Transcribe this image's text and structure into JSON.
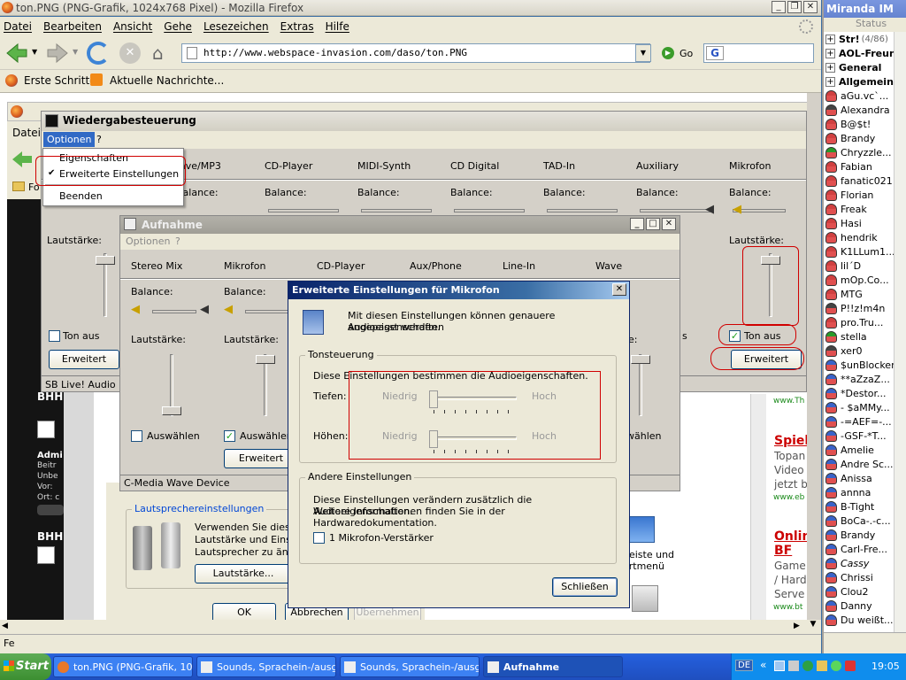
{
  "firefox": {
    "title": "ton.PNG (PNG-Grafik, 1024x768 Pixel) - Mozilla Firefox",
    "menu": [
      "Datei",
      "Bearbeiten",
      "Ansicht",
      "Gehe",
      "Lesezeichen",
      "Extras",
      "Hilfe"
    ],
    "url": "http://www.webspace-invasion.com/daso/ton.PNG",
    "go_label": "Go",
    "bookmarks": [
      "Erste Schritte",
      "Aktuelle Nachrichte..."
    ],
    "status": "Fe"
  },
  "background_page": {
    "lautsprecher_title": "Lautsprechereinstellungen",
    "lautsprecher_text": [
      "Verwenden Sie diese",
      "Lautstärke und Einste",
      "Lautsprecher zu ände"
    ],
    "lautstaerke_btn": "Lautstärke...",
    "ok_btn": "OK",
    "abbrechen_btn": "Abbrechen",
    "uebernehmen_btn": "Übernehmen",
    "right_links": [
      "Spiel",
      "Topan",
      "Video",
      "jetzt b",
      "Onlin",
      "BF",
      "Game",
      "/ Hard",
      "Serve"
    ],
    "right_small": [
      "www.Th",
      "www.eb",
      "www.bt"
    ],
    "left_labels": [
      "BHH",
      "Admi",
      "Beitr",
      "Unbe",
      "Vor:",
      "Ort: c",
      "BHH"
    ],
    "misc": [
      "deiste und",
      "artmenü",
      "Datei",
      "Fo"
    ]
  },
  "wiedergabe": {
    "title": "Wiedergabesteuerung",
    "menu": [
      "Optionen",
      "?"
    ],
    "menu_items": [
      "Eigenschaften",
      "Erweiterte Einstellungen",
      "Beenden"
    ],
    "channels": [
      "ave/MP3",
      "CD-Player",
      "MIDI-Synth",
      "CD Digital",
      "TAD-In",
      "Auxiliary",
      "Mikrofon"
    ],
    "balance": "Balance:",
    "lautstaerke": "Lautstärke:",
    "ton_aus": "Ton aus",
    "erweitert": "Erweitert",
    "status": "SB Live! Audio [D",
    "s_label": "s"
  },
  "aufnahme": {
    "title": "Aufnahme",
    "menu": [
      "Optionen",
      "?"
    ],
    "channels": [
      "Stereo Mix",
      "Mikrofon",
      "CD-Player",
      "Aux/Phone",
      "Line-In",
      "Wave"
    ],
    "balance": "Balance:",
    "lautstaerke": "Lautstärke:",
    "auswaehlen": "Auswählen",
    "erweitert": "Erweitert",
    "ke_label": "ke:",
    "waehlen_label": "wählen",
    "status": "C-Media Wave Device"
  },
  "dialog": {
    "title": "Erweiterte Einstellungen für Mikrofon",
    "intro": [
      "Mit diesen Einstellungen können genauere Audioeigenschaften",
      "angepasst werden."
    ],
    "tone_group": "Tonsteuerung",
    "tone_desc": "Diese Einstellungen bestimmen die Audioeigenschaften.",
    "tiefen": "Tiefen:",
    "hoehen": "Höhen:",
    "niedrig": "Niedrig",
    "hoch": "Hoch",
    "other_group": "Andere Einstellungen",
    "other_desc": [
      "Diese Einstellungen verändern zusätzlich die Audioeigenschaften.",
      "Weitere Informationen finden Sie in der Hardwaredokumentation."
    ],
    "boost_label": "1  Mikrofon-Verstärker",
    "close_btn": "Schließen"
  },
  "miranda": {
    "title": "Miranda IM",
    "status": "Status",
    "groups": [
      {
        "name": "Str!",
        "extra": "(4/86)"
      },
      {
        "name": "AOL-Freun",
        "extra": ""
      },
      {
        "name": "General",
        "extra": ""
      },
      {
        "name": "Allgemein",
        "extra": ""
      }
    ],
    "contacts": [
      "aGu.vc`...",
      "Alexandra",
      "B@$t!",
      "Brandy",
      "Chryzzle...",
      "Fabian",
      "fanatic021",
      "Florian",
      "Freak",
      "Hasi",
      "hendrik",
      "K1LLum1...",
      "lil´D",
      "mOp.Co...",
      "MTG",
      "P!!z!m4n",
      "pro.Tru...",
      "stella",
      "xer0",
      "$unBlocker",
      "**aZzaZ...",
      "*Destor...",
      "- $aMMy...",
      "-=AEF=-...",
      "-GSF-*T...",
      "Amelie",
      "Andre Sc...",
      "Anissa",
      "annna",
      "B-Tight",
      "BoCa-.-c...",
      "Brandy",
      "Carl-Fre...",
      "Cassy",
      "Chrissi",
      "Clou2",
      "Danny",
      "Du weißt..."
    ]
  },
  "taskbar": {
    "start": "Start",
    "items": [
      "ton.PNG (PNG-Grafik, 10...",
      "Sounds, Sprachein-/ausg...",
      "Sounds, Sprachein-/ausg...",
      "Aufnahme"
    ],
    "lang": "DE",
    "clock": "19:05"
  }
}
